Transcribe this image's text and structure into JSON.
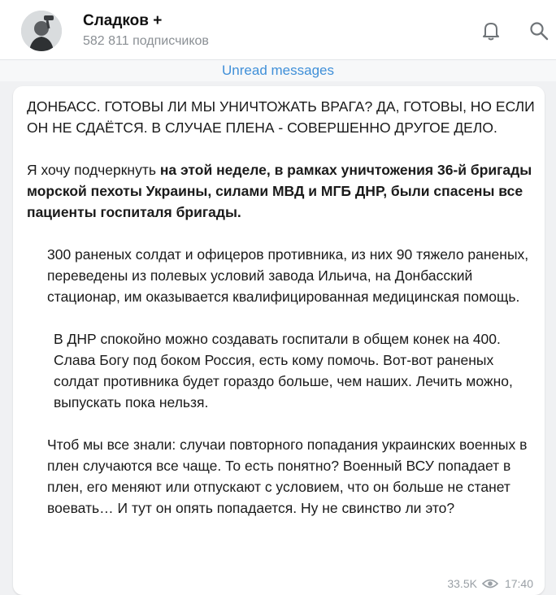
{
  "channel": {
    "name": "Сладков +",
    "subscribers": "582 811 подписчиков"
  },
  "icons": {
    "bell": "bell-icon",
    "search": "search-icon",
    "views": "eye-icon"
  },
  "colors": {
    "accent": "#3f8fd8",
    "background": "#f0f1f3",
    "bubble": "#ffffff"
  },
  "divider": {
    "label": "Unread messages"
  },
  "message": {
    "p1": "ДОНБАСС. ГОТОВЫ ЛИ МЫ УНИЧТОЖАТЬ ВРАГА? ДА, ГОТОВЫ, НО ЕСЛИ ОН НЕ СДАЁТСЯ. В СЛУЧАЕ ПЛЕНА - СОВЕРШЕННО ДРУГОЕ ДЕЛО.",
    "p2_plain": "Я хочу подчеркнуть ",
    "p2_bold": "на этой неделе, в рамках уничтожения 36-й бригады морской пехоты Украины, силами МВД и МГБ ДНР, были спасены все пациенты госпиталя бригады.",
    "p3": "300 раненых солдат и офицеров противника, из них 90 тяжело раненых, переведены из полевых условий завода Ильича, на Донбасский стационар, им оказывается квалифицированная медицинская помощь.",
    "p4": "В ДНР спокойно можно создавать госпитали в общем конек на 400. Слава Богу под боком Россия, есть кому помочь. Вот-вот раненых солдат противника будет гораздо больше, чем наших. Лечить можно, выпускать пока нельзя.",
    "p5": "Чтоб мы все знали: случаи повторного попадания украинских военных в плен случаются все чаще. То есть понятно? Военный ВСУ попадает в плен, его меняют или отпускают с условием, что он больше не станет воевать… И тут он опять попадается. Ну не свинство ли это?",
    "views": "33.5K",
    "time": "17:40"
  }
}
